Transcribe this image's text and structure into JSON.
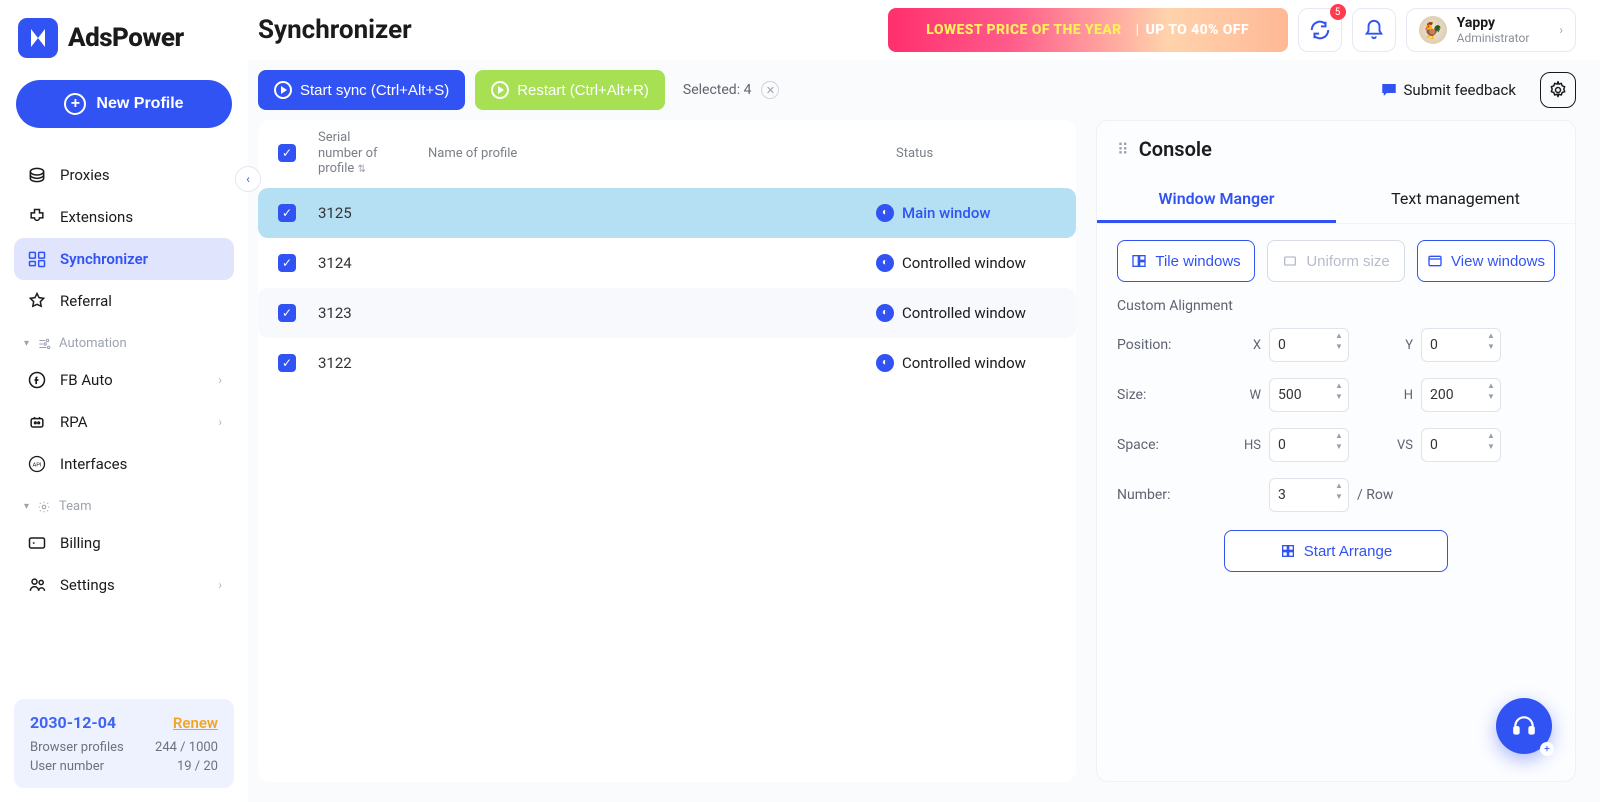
{
  "brand": {
    "name": "AdsPower"
  },
  "new_profile_label": "New Profile",
  "sidebar": {
    "items": [
      {
        "label": "Proxies",
        "active": false,
        "icon": "proxies"
      },
      {
        "label": "Extensions",
        "active": false,
        "icon": "extensions"
      },
      {
        "label": "Synchronizer",
        "active": true,
        "icon": "synchronizer"
      },
      {
        "label": "Referral",
        "active": false,
        "icon": "referral"
      }
    ],
    "group_automation": "Automation",
    "automation_items": [
      {
        "label": "FB Auto",
        "chev": true
      },
      {
        "label": "RPA",
        "chev": true
      },
      {
        "label": "Interfaces",
        "chev": false
      }
    ],
    "group_team": "Team",
    "team_items": [
      {
        "label": "Billing",
        "chev": false
      },
      {
        "label": "Settings",
        "chev": true
      }
    ]
  },
  "subscription": {
    "date": "2030-12-04",
    "renew": "Renew",
    "profiles_label": "Browser profiles",
    "profiles_value": "244 / 1000",
    "users_label": "User number",
    "users_value": "19 / 20"
  },
  "header": {
    "title": "Synchronizer",
    "promo_left": "LOWEST PRICE OF THE YEAR",
    "promo_right": "UP TO 40% OFF",
    "badge_count": "5",
    "user_name": "Yappy",
    "user_role": "Administrator"
  },
  "actions": {
    "start_sync": "Start sync (Ctrl+Alt+S)",
    "restart": "Restart (Ctrl+Alt+R)",
    "selected_prefix": "Selected:",
    "selected_count": "4",
    "submit_feedback": "Submit feedback"
  },
  "table": {
    "col_serial_l1": "Serial",
    "col_serial_l2": "number of",
    "col_serial_l3": "profile",
    "col_name": "Name of profile",
    "col_status": "Status",
    "rows": [
      {
        "serial": "3125",
        "name": "",
        "status_label": "Main window",
        "status_type": "main",
        "selected": true
      },
      {
        "serial": "3124",
        "name": "",
        "status_label": "Controlled window",
        "status_type": "ctrl",
        "selected": false
      },
      {
        "serial": "3123",
        "name": "",
        "status_label": "Controlled window",
        "status_type": "ctrl",
        "selected": false
      },
      {
        "serial": "3122",
        "name": "",
        "status_label": "Controlled window",
        "status_type": "ctrl",
        "selected": false
      }
    ]
  },
  "console": {
    "title": "Console",
    "tab_window": "Window Manger",
    "tab_text": "Text management",
    "btn_tile": "Tile windows",
    "btn_uniform": "Uniform size",
    "btn_view": "View windows",
    "custom_alignment": "Custom Alignment",
    "position_label": "Position:",
    "size_label": "Size:",
    "space_label": "Space:",
    "number_label": "Number:",
    "number_tail": "/ Row",
    "x_key": "X",
    "y_key": "Y",
    "w_key": "W",
    "h_key": "H",
    "hs_key": "HS",
    "vs_key": "VS",
    "x_val": "0",
    "y_val": "0",
    "w_val": "500",
    "h_val": "200",
    "hs_val": "0",
    "vs_val": "0",
    "num_val": "3",
    "start_arrange": "Start Arrange"
  }
}
